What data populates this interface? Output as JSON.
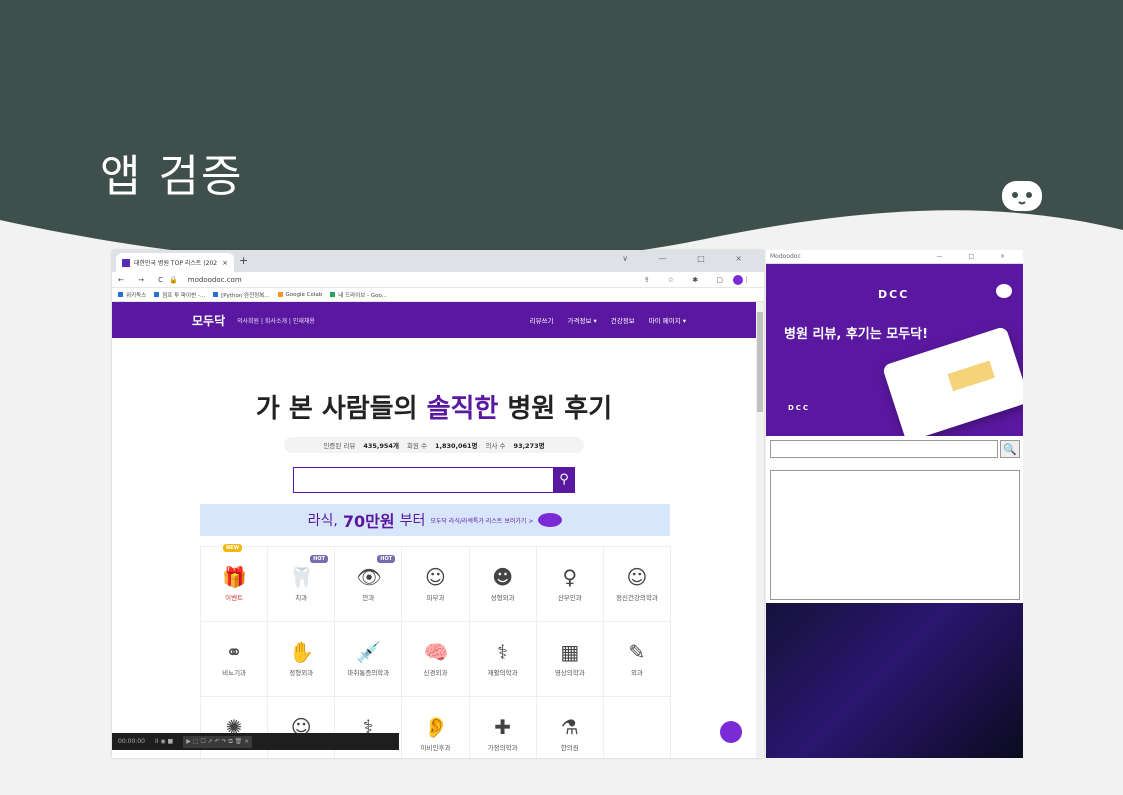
{
  "slide": {
    "title": "앱 검증"
  },
  "browser": {
    "tab_title": "대한민국 병원 TOP 리스트 (202",
    "tab_close": "×",
    "new_tab": "+",
    "window_controls": "∨ — □ ×",
    "nav_buttons": "← → C",
    "url": "modoodoc.com",
    "toolbar_icons": "⇪ ☆ ✱ ▢",
    "bookmarks": [
      "위키독스",
      "점프 투 파이썬 -...",
      "[Python 완전정복...",
      "Google Colab",
      "내 드라이브 - Goo..."
    ]
  },
  "site": {
    "logo": "모두닥",
    "nav_links": "의사회원 | 회사소개 | 인재채용",
    "nav_right": [
      "리뷰쓰기",
      "가격정보 ▾",
      "건강정보",
      "마이 페이지 ▾"
    ],
    "hero_title_before": "가 본 사람들의 ",
    "hero_title_highlight": "솔직한",
    "hero_title_after": " 병원 후기",
    "stats": {
      "reviews_label": "인증된 리뷰",
      "reviews_value": "435,954개",
      "members_label": "회원 수",
      "members_value": "1,830,061명",
      "doctors_label": "의사 수",
      "doctors_value": "93,273명"
    },
    "search_placeholder": "",
    "banner": {
      "prefix": "라식, ",
      "price": "70만원",
      "suffix": "부터",
      "small": "모두닥 라식/라섹특가 리스트 보러가기 >"
    },
    "categories": [
      {
        "label": "이벤트",
        "badge": "NEW",
        "icon": "gift-icon"
      },
      {
        "label": "치과",
        "badge": "HOT",
        "icon": "tooth-icon"
      },
      {
        "label": "안과",
        "badge": "HOT",
        "icon": "eye-icon"
      },
      {
        "label": "피부과",
        "badge": "",
        "icon": "face-icon"
      },
      {
        "label": "성형외과",
        "badge": "",
        "icon": "face-smile-icon"
      },
      {
        "label": "산부인과",
        "badge": "",
        "icon": "uterus-icon"
      },
      {
        "label": "정신건강의학과",
        "badge": "",
        "icon": "mind-icon"
      },
      {
        "label": "비뇨기과",
        "badge": "",
        "icon": "kidney-icon"
      },
      {
        "label": "정형외과",
        "badge": "",
        "icon": "cast-icon"
      },
      {
        "label": "마취통증의학과",
        "badge": "",
        "icon": "syringe-icon"
      },
      {
        "label": "신경외과",
        "badge": "",
        "icon": "brain-icon"
      },
      {
        "label": "재활의학과",
        "badge": "",
        "icon": "crutch-icon"
      },
      {
        "label": "영상의학과",
        "badge": "",
        "icon": "xray-icon"
      },
      {
        "label": "외과",
        "badge": "",
        "icon": "scalpel-icon"
      },
      {
        "label": "",
        "badge": "",
        "icon": "virus-icon"
      },
      {
        "label": "",
        "badge": "",
        "icon": "baby-icon"
      },
      {
        "label": "",
        "badge": "",
        "icon": "stethoscope-icon"
      },
      {
        "label": "이비인후과",
        "badge": "",
        "icon": "ear-icon"
      },
      {
        "label": "가정의학과",
        "badge": "",
        "icon": "cross-icon"
      },
      {
        "label": "한의원",
        "badge": "",
        "icon": "mortar-icon"
      },
      {
        "label": "",
        "badge": "",
        "icon": ""
      }
    ]
  },
  "recorder": {
    "time": "00:00:00",
    "controls": "II ◉ ■",
    "tools": "▶ ⬚ ☐ ↗ ↶ ↷ ⧉ 🗑 ×"
  },
  "app": {
    "title": "Modoodoc",
    "window_controls": "— □ ×",
    "logo": "DCC",
    "headline": "병원 리뷰, 후기는 모두닥!",
    "small_logo": "DCC",
    "search_value": "",
    "search_icon": "magnifier-icon"
  }
}
